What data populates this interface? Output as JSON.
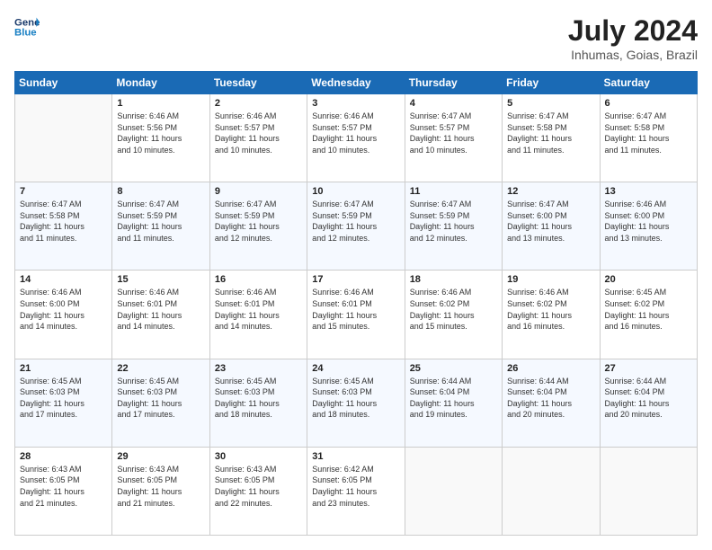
{
  "logo": {
    "line1": "General",
    "line2": "Blue"
  },
  "header": {
    "title": "July 2024",
    "subtitle": "Inhumas, Goias, Brazil"
  },
  "weekdays": [
    "Sunday",
    "Monday",
    "Tuesday",
    "Wednesday",
    "Thursday",
    "Friday",
    "Saturday"
  ],
  "weeks": [
    [
      {
        "day": "",
        "info": ""
      },
      {
        "day": "1",
        "info": "Sunrise: 6:46 AM\nSunset: 5:56 PM\nDaylight: 11 hours\nand 10 minutes."
      },
      {
        "day": "2",
        "info": "Sunrise: 6:46 AM\nSunset: 5:57 PM\nDaylight: 11 hours\nand 10 minutes."
      },
      {
        "day": "3",
        "info": "Sunrise: 6:46 AM\nSunset: 5:57 PM\nDaylight: 11 hours\nand 10 minutes."
      },
      {
        "day": "4",
        "info": "Sunrise: 6:47 AM\nSunset: 5:57 PM\nDaylight: 11 hours\nand 10 minutes."
      },
      {
        "day": "5",
        "info": "Sunrise: 6:47 AM\nSunset: 5:58 PM\nDaylight: 11 hours\nand 11 minutes."
      },
      {
        "day": "6",
        "info": "Sunrise: 6:47 AM\nSunset: 5:58 PM\nDaylight: 11 hours\nand 11 minutes."
      }
    ],
    [
      {
        "day": "7",
        "info": "Sunrise: 6:47 AM\nSunset: 5:58 PM\nDaylight: 11 hours\nand 11 minutes."
      },
      {
        "day": "8",
        "info": "Sunrise: 6:47 AM\nSunset: 5:59 PM\nDaylight: 11 hours\nand 11 minutes."
      },
      {
        "day": "9",
        "info": "Sunrise: 6:47 AM\nSunset: 5:59 PM\nDaylight: 11 hours\nand 12 minutes."
      },
      {
        "day": "10",
        "info": "Sunrise: 6:47 AM\nSunset: 5:59 PM\nDaylight: 11 hours\nand 12 minutes."
      },
      {
        "day": "11",
        "info": "Sunrise: 6:47 AM\nSunset: 5:59 PM\nDaylight: 11 hours\nand 12 minutes."
      },
      {
        "day": "12",
        "info": "Sunrise: 6:47 AM\nSunset: 6:00 PM\nDaylight: 11 hours\nand 13 minutes."
      },
      {
        "day": "13",
        "info": "Sunrise: 6:46 AM\nSunset: 6:00 PM\nDaylight: 11 hours\nand 13 minutes."
      }
    ],
    [
      {
        "day": "14",
        "info": "Sunrise: 6:46 AM\nSunset: 6:00 PM\nDaylight: 11 hours\nand 14 minutes."
      },
      {
        "day": "15",
        "info": "Sunrise: 6:46 AM\nSunset: 6:01 PM\nDaylight: 11 hours\nand 14 minutes."
      },
      {
        "day": "16",
        "info": "Sunrise: 6:46 AM\nSunset: 6:01 PM\nDaylight: 11 hours\nand 14 minutes."
      },
      {
        "day": "17",
        "info": "Sunrise: 6:46 AM\nSunset: 6:01 PM\nDaylight: 11 hours\nand 15 minutes."
      },
      {
        "day": "18",
        "info": "Sunrise: 6:46 AM\nSunset: 6:02 PM\nDaylight: 11 hours\nand 15 minutes."
      },
      {
        "day": "19",
        "info": "Sunrise: 6:46 AM\nSunset: 6:02 PM\nDaylight: 11 hours\nand 16 minutes."
      },
      {
        "day": "20",
        "info": "Sunrise: 6:45 AM\nSunset: 6:02 PM\nDaylight: 11 hours\nand 16 minutes."
      }
    ],
    [
      {
        "day": "21",
        "info": "Sunrise: 6:45 AM\nSunset: 6:03 PM\nDaylight: 11 hours\nand 17 minutes."
      },
      {
        "day": "22",
        "info": "Sunrise: 6:45 AM\nSunset: 6:03 PM\nDaylight: 11 hours\nand 17 minutes."
      },
      {
        "day": "23",
        "info": "Sunrise: 6:45 AM\nSunset: 6:03 PM\nDaylight: 11 hours\nand 18 minutes."
      },
      {
        "day": "24",
        "info": "Sunrise: 6:45 AM\nSunset: 6:03 PM\nDaylight: 11 hours\nand 18 minutes."
      },
      {
        "day": "25",
        "info": "Sunrise: 6:44 AM\nSunset: 6:04 PM\nDaylight: 11 hours\nand 19 minutes."
      },
      {
        "day": "26",
        "info": "Sunrise: 6:44 AM\nSunset: 6:04 PM\nDaylight: 11 hours\nand 20 minutes."
      },
      {
        "day": "27",
        "info": "Sunrise: 6:44 AM\nSunset: 6:04 PM\nDaylight: 11 hours\nand 20 minutes."
      }
    ],
    [
      {
        "day": "28",
        "info": "Sunrise: 6:43 AM\nSunset: 6:05 PM\nDaylight: 11 hours\nand 21 minutes."
      },
      {
        "day": "29",
        "info": "Sunrise: 6:43 AM\nSunset: 6:05 PM\nDaylight: 11 hours\nand 21 minutes."
      },
      {
        "day": "30",
        "info": "Sunrise: 6:43 AM\nSunset: 6:05 PM\nDaylight: 11 hours\nand 22 minutes."
      },
      {
        "day": "31",
        "info": "Sunrise: 6:42 AM\nSunset: 6:05 PM\nDaylight: 11 hours\nand 23 minutes."
      },
      {
        "day": "",
        "info": ""
      },
      {
        "day": "",
        "info": ""
      },
      {
        "day": "",
        "info": ""
      }
    ]
  ]
}
